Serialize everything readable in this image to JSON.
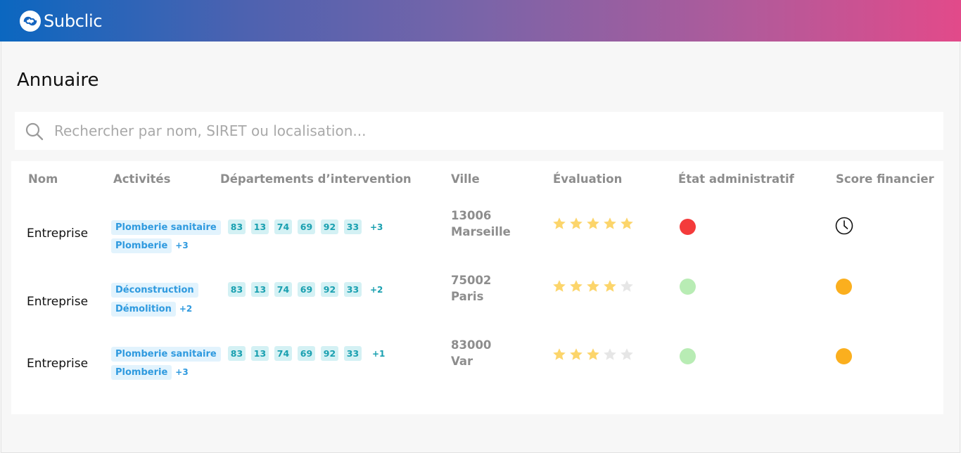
{
  "app": {
    "name": "Subclic"
  },
  "page": {
    "title": "Annuaire"
  },
  "search": {
    "placeholder": "Rechercher par nom, SIRET ou localisation..."
  },
  "table": {
    "headers": [
      "Nom",
      "Activités",
      "Départements d’intervention",
      "Ville",
      "Évaluation",
      "État administratif",
      "Score financier"
    ],
    "rows": [
      {
        "name": "Entreprise",
        "activities": [
          "Plomberie sanitaire",
          "Plomberie"
        ],
        "activities_more": "+3",
        "departments": [
          "83",
          "13",
          "74",
          "69",
          "92",
          "33"
        ],
        "departments_more": "+3",
        "postal_code": "13006",
        "city": "Marseille",
        "rating": 5,
        "rating_max": 5,
        "admin_status": "red",
        "financial_score": "pending"
      },
      {
        "name": "Entreprise",
        "activities": [
          "Déconstruction",
          "Démolition"
        ],
        "activities_more": "+2",
        "departments": [
          "83",
          "13",
          "74",
          "69",
          "92",
          "33"
        ],
        "departments_more": "+2",
        "postal_code": "75002",
        "city": "Paris",
        "rating": 4,
        "rating_max": 5,
        "admin_status": "green",
        "financial_score": "orange"
      },
      {
        "name": "Entreprise",
        "activities": [
          "Plomberie sanitaire",
          "Plomberie"
        ],
        "activities_more": "+3",
        "departments": [
          "83",
          "13",
          "74",
          "69",
          "92",
          "33"
        ],
        "departments_more": "+1",
        "postal_code": "83000",
        "city": "Var",
        "rating": 3,
        "rating_max": 5,
        "admin_status": "green",
        "financial_score": "orange"
      }
    ]
  },
  "colors": {
    "red": "#f43b3b",
    "green": "#b8ecb4",
    "orange": "#fbaf1e",
    "star_on": "#fcd56b",
    "star_off": "#e6e6e6",
    "accent": "#2f9adf",
    "dep_text": "#1aa0b0"
  },
  "icons": {
    "search": "search-icon",
    "pending": "clock-icon",
    "rating": "star-icon",
    "logo": "subclic-logo-icon"
  }
}
